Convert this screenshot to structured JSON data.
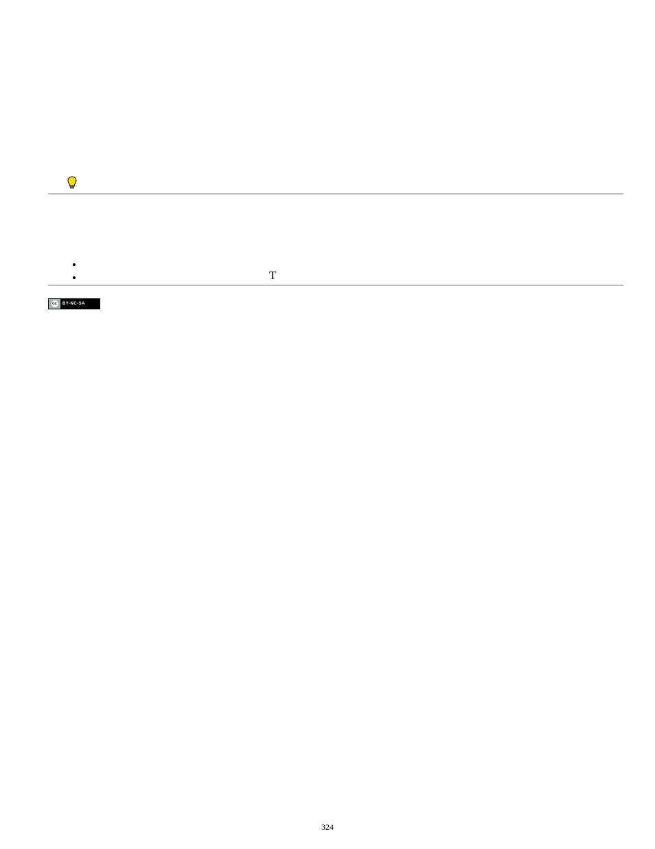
{
  "bullet_char": "T",
  "cc": {
    "symbol": "cc",
    "label": "BY-NC-SA"
  },
  "page_number": "324"
}
